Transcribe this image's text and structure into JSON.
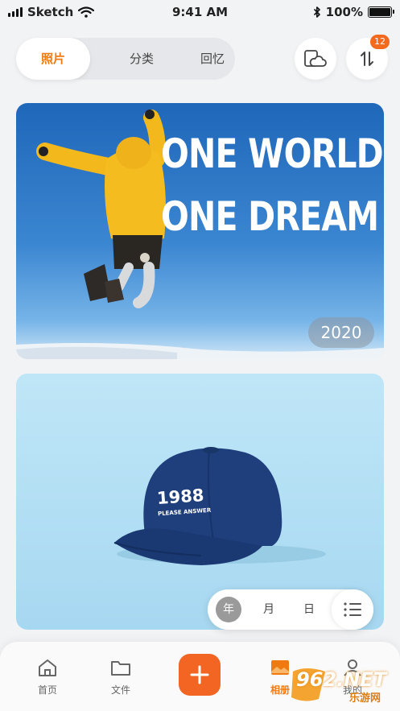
{
  "status_bar": {
    "carrier": "Sketch",
    "time": "9:41 AM",
    "battery": "100%"
  },
  "top_tabs": [
    {
      "label": "照片",
      "active": true
    },
    {
      "label": "分类"
    },
    {
      "label": "回忆"
    }
  ],
  "header_actions": {
    "sort_badge_count": "12"
  },
  "cards": [
    {
      "year": "2020",
      "slogan_line1": "ONE WORLD",
      "slogan_line2": "ONE DREAM"
    },
    {
      "cap_text": "1988",
      "cap_subtext": "PLEASE ANSWER"
    }
  ],
  "date_toggle": {
    "options": [
      "年",
      "月",
      "日"
    ],
    "selected": "年"
  },
  "bottom_nav": [
    {
      "label": "首页"
    },
    {
      "label": "文件"
    },
    {
      "label": "相册",
      "active": true
    },
    {
      "label": "我的"
    }
  ],
  "watermark": {
    "text": "962.NET",
    "sub": "乐游网"
  },
  "colors": {
    "accent": "#f07a12",
    "add_button": "#f26522",
    "badge": "#f36a1e"
  }
}
